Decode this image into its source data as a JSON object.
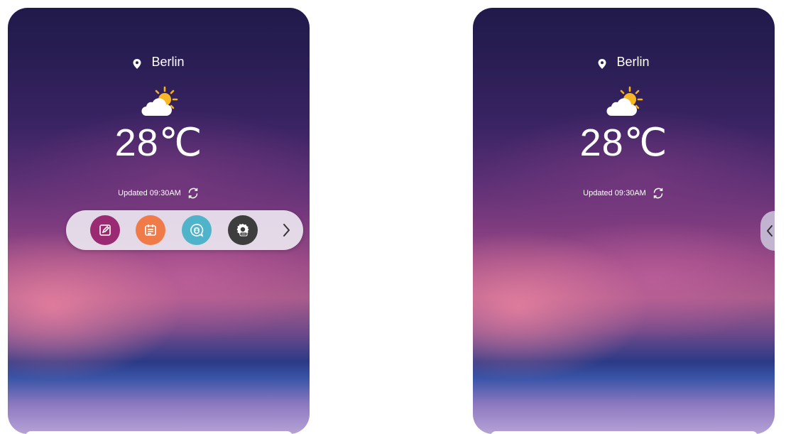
{
  "screens": [
    {
      "state": "tray-open",
      "location": "Berlin",
      "temperature": "28",
      "unit": "℃",
      "updated": "Updated 09:30AM",
      "weather_icon": "partly-cloudy-icon",
      "tray": {
        "apps": [
          {
            "name": "notes-icon",
            "color": "#9a2b73"
          },
          {
            "name": "calendar-icon",
            "color": "#f07a48"
          },
          {
            "name": "assistant-icon",
            "color": "#4fb3c9"
          },
          {
            "name": "settings-icon",
            "color": "#3d3d3d"
          }
        ],
        "collapse_icon": "chevron-right-icon"
      }
    },
    {
      "state": "tray-collapsed",
      "location": "Berlin",
      "temperature": "28",
      "unit": "℃",
      "updated": "Updated 09:30AM",
      "weather_icon": "partly-cloudy-icon",
      "handle_icon": "chevron-left-icon"
    }
  ]
}
